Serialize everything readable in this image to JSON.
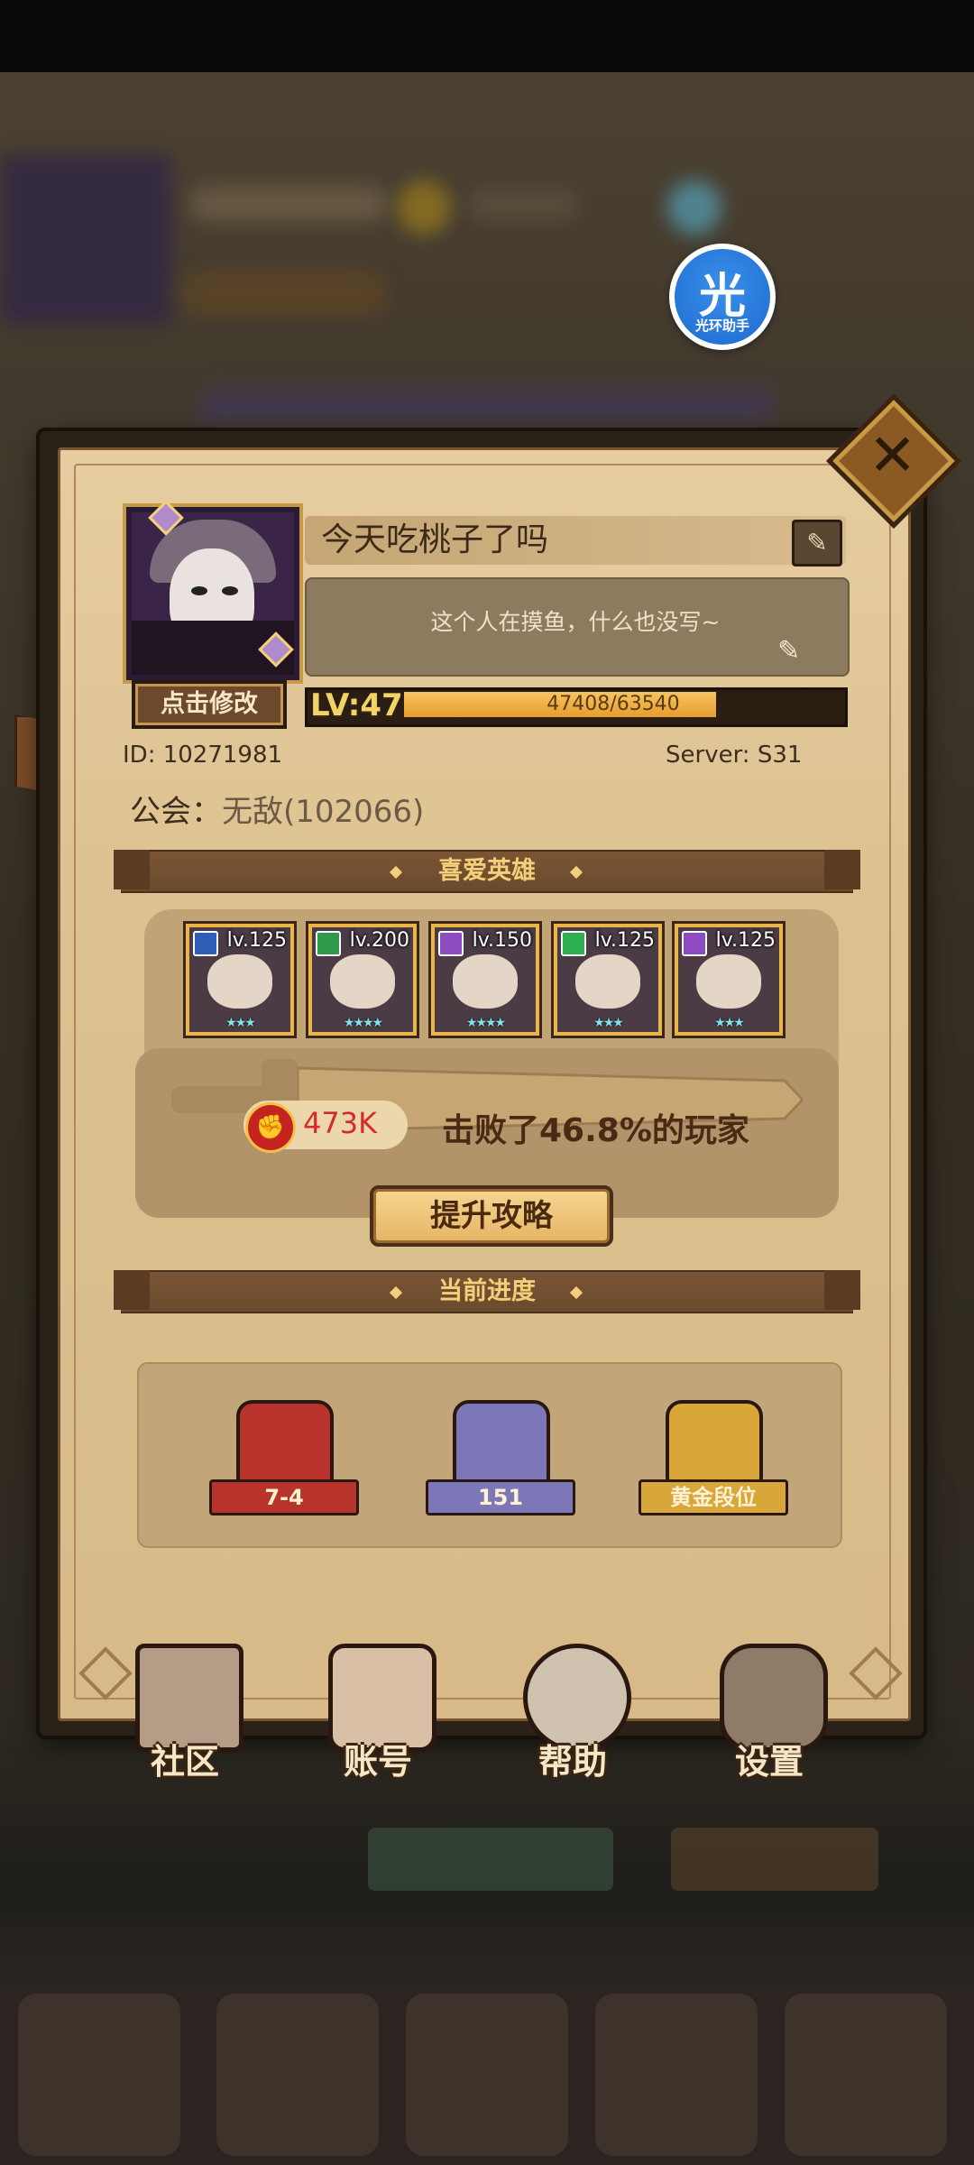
{
  "helper_badge": {
    "glyph": "光",
    "label": "光环助手"
  },
  "profile": {
    "name": "今天吃桃子了吗",
    "signature": "这个人在摸鱼，什么也没写~",
    "edit_avatar_label": "点击修改",
    "level_label": "LV:47",
    "exp_text": "47408/63540",
    "exp_progress": 0.746,
    "id_label": "ID: 10271981",
    "server_label": "Server: S31",
    "guild_prefix": "公会：",
    "guild_value": "无敌(102066)"
  },
  "sections": {
    "favorite_heroes": "喜爱英雄",
    "current_progress": "当前进度"
  },
  "heroes": [
    {
      "level": "lv.125",
      "class_color": "#2d5fb8",
      "stars": 3
    },
    {
      "level": "lv.200",
      "class_color": "#2f9a4a",
      "stars": 4
    },
    {
      "level": "lv.150",
      "class_color": "#8d4bc0",
      "stars": 4
    },
    {
      "level": "lv.125",
      "class_color": "#2fae4f",
      "stars": 3
    },
    {
      "level": "lv.125",
      "class_color": "#8d4bc0",
      "stars": 3
    }
  ],
  "power": {
    "value": "473K",
    "defeat_text": "击败了46.8%的玩家",
    "strategy_label": "提升攻略"
  },
  "progress": [
    {
      "label": "7-4",
      "color": "#b8332b"
    },
    {
      "label": "151",
      "color": "#7c78b8"
    },
    {
      "label": "黄金段位",
      "color": "#d9a63a"
    }
  ],
  "bottom_buttons": [
    {
      "label": "社区",
      "icon": "castle-icon"
    },
    {
      "label": "账号",
      "icon": "account-card-icon"
    },
    {
      "label": "帮助",
      "icon": "chat-bubble-icon"
    },
    {
      "label": "设置",
      "icon": "gear-icon"
    }
  ],
  "colors": {
    "accent_gold": "#f3cf7a",
    "frame_dark": "#2a2118",
    "parchment": "#e2c899",
    "power_red": "#d22b2b"
  }
}
